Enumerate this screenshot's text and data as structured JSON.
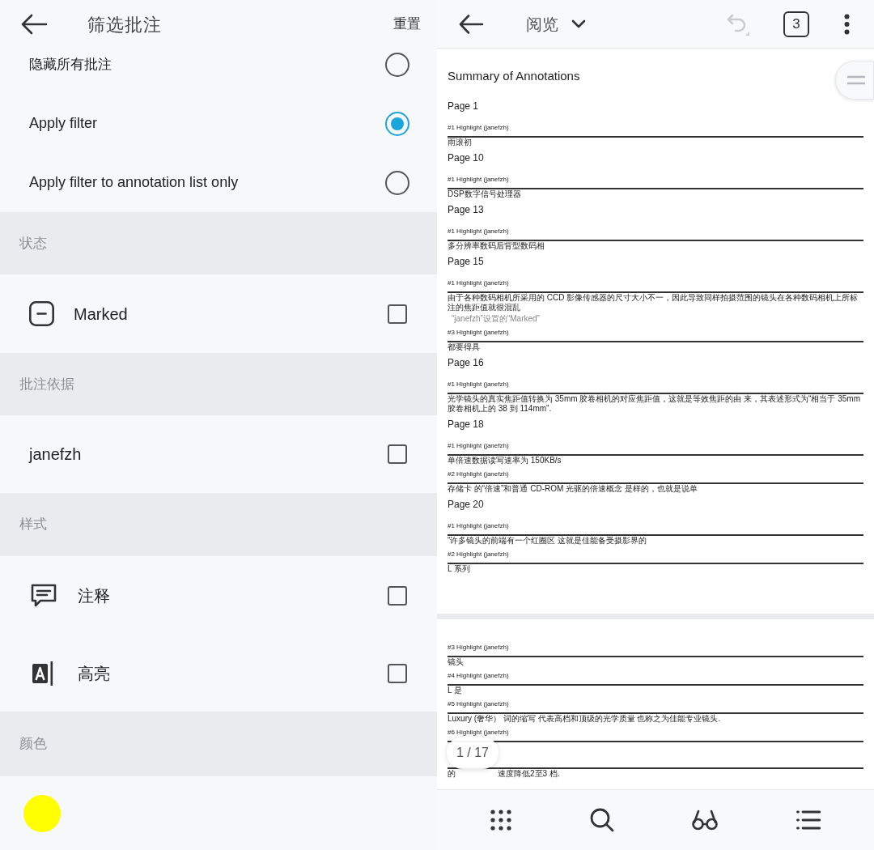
{
  "filter_panel": {
    "title": "筛选批注",
    "reset": "重置",
    "visibility_options": [
      {
        "label": "隐藏所有批注",
        "selected": false
      },
      {
        "label": "Apply filter",
        "selected": true
      },
      {
        "label": "Apply filter to annotation list only",
        "selected": false
      }
    ],
    "sections": [
      {
        "title": "状态",
        "kind": "checklist",
        "items": [
          {
            "kind": "marked",
            "label": "Marked",
            "checked": false
          }
        ]
      },
      {
        "title": "批注依据",
        "kind": "checklist",
        "items": [
          {
            "kind": "plain",
            "label": "janefzh",
            "checked": false
          }
        ]
      },
      {
        "title": "样式",
        "kind": "checklist",
        "items": [
          {
            "kind": "note",
            "label": "注释",
            "checked": false
          },
          {
            "kind": "highlight",
            "label": "高亮",
            "checked": false
          }
        ]
      },
      {
        "title": "颜色",
        "kind": "colors",
        "colors": [
          {
            "color": "#ffff00"
          }
        ]
      }
    ]
  },
  "viewer": {
    "mode": "阅览",
    "undo": {
      "disabled": true
    },
    "tab_count": "3",
    "document": {
      "pages": [
        {
          "title": "Summary of Annotations",
          "groups": [
            {
              "heading": "Page 1",
              "entries": [
                {
                  "kind": "highlight",
                  "label": "#1 Highlight (janefzh)",
                  "text": "雨滚初"
                }
              ]
            },
            {
              "heading": "Page 10",
              "entries": [
                {
                  "kind": "highlight",
                  "label": "#1 Highlight (janefzh)",
                  "text": "DSP数字信号处理器"
                }
              ]
            },
            {
              "heading": "Page 13",
              "entries": [
                {
                  "kind": "highlight",
                  "label": "#1 Highlight (janefzh)",
                  "text": "多分辨率数码后背型数码相"
                }
              ]
            },
            {
              "heading": "Page 15",
              "entries": [
                {
                  "kind": "highlight",
                  "label": "#1 Highlight (janefzh)",
                  "text": "由于各种数码相机所采用的 CCD 影像传感器的尺寸大小不一，因此导致同样拍摄范围的镜头在各种数码相机上所标注的焦距值就很混乱"
                },
                {
                  "kind": "note",
                  "text": "“janefzh”设置的“Marked”"
                },
                {
                  "kind": "highlight",
                  "label": "#3 Highlight (janefzh)",
                  "text": "都要得具"
                }
              ]
            },
            {
              "heading": "Page 16",
              "entries": [
                {
                  "kind": "highlight",
                  "label": "#1 Highlight (janefzh)",
                  "text": "光学镜头的真实焦距值转换为 35mm 胶卷相机的对应焦距值，这就是等效焦距的由 来，其表述形式为“相当于 35mm 胶卷相机上的 38 到 114mm”."
                }
              ]
            },
            {
              "heading": "Page 18",
              "entries": [
                {
                  "kind": "highlight",
                  "label": "#1 Highlight (janefzh)",
                  "text": "单倍速数据读写速率为 150KB/s"
                },
                {
                  "kind": "highlight",
                  "label": "#2 Highlight (janefzh)",
                  "text": "存储卡 的“倍速”和普通 CD-ROM 光驱的倍速概念 是样的，也就是说单"
                }
              ]
            },
            {
              "heading": "Page 20",
              "entries": [
                {
                  "kind": "highlight",
                  "label": "#1 Highlight (janefzh)",
                  "text": "“许多镜头的前端有一个红圈区 这就是佳能备受摄影界的"
                },
                {
                  "kind": "highlight",
                  "label": "#2 Highlight (janefzh)",
                  "text": "L 系列"
                }
              ]
            }
          ]
        },
        {
          "groups": [
            {
              "entries": [
                {
                  "kind": "highlight",
                  "label": "#3 Highlight (janefzh)",
                  "text": "镜头"
                },
                {
                  "kind": "highlight",
                  "label": "#4 Highlight (janefzh)",
                  "text": "L 是"
                },
                {
                  "kind": "highlight",
                  "label": "#5 Highlight (janefzh)",
                  "text": "Luxury (奢华） 词的缩写 代表高档和顶级的光学质量 也称之为佳能专业镜头."
                },
                {
                  "kind": "label_only",
                  "label": "#6 Highlight (janefzh)"
                },
                {
                  "kind": "covered",
                  "fragments": [
                    "的",
                    "速度降低2至3 档."
                  ]
                }
              ]
            }
          ]
        }
      ]
    },
    "page_indicator": "1 / 17"
  }
}
